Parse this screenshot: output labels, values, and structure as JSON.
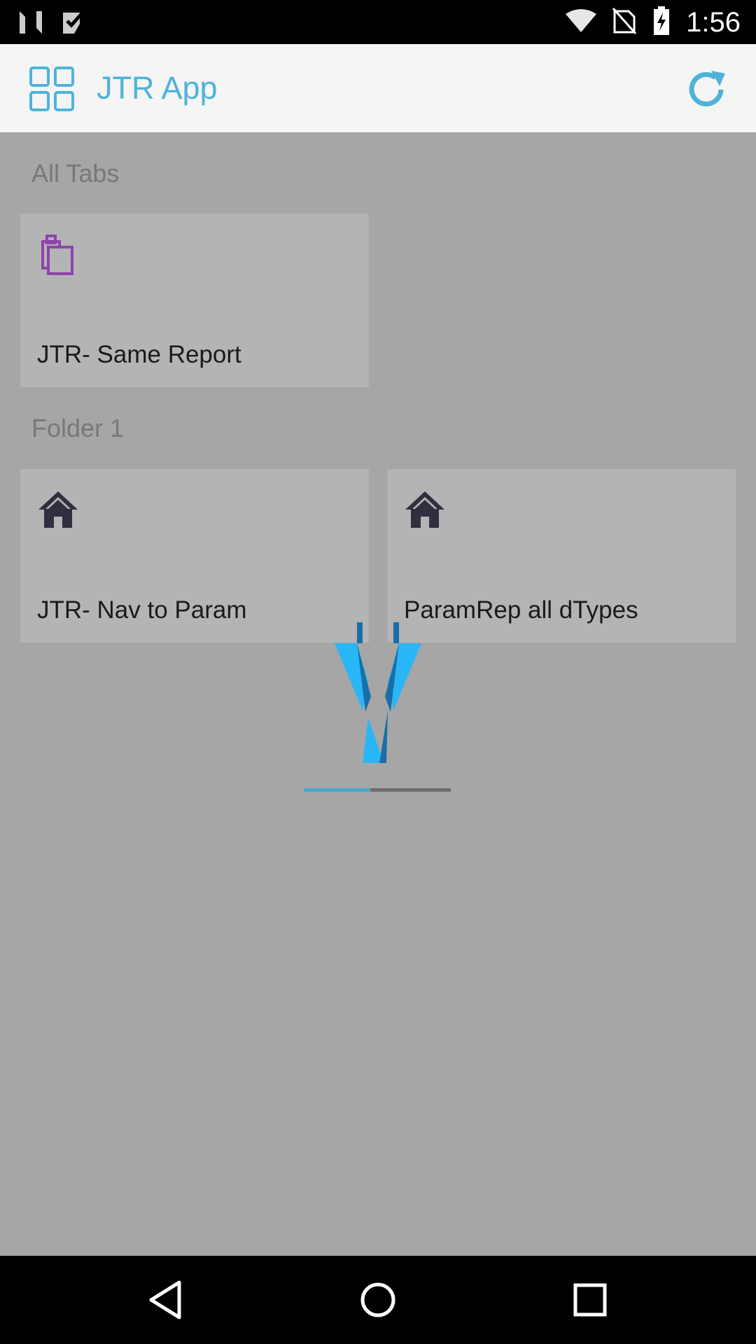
{
  "status_bar": {
    "time": "1:56",
    "left_icons": [
      "n-logo-icon",
      "check-notification-icon"
    ],
    "right_icons": [
      "wifi-icon",
      "no-sim-icon",
      "battery-charging-icon"
    ]
  },
  "app_bar": {
    "title": "JTR App",
    "app_icon": "grid-icon",
    "refresh_icon": "refresh-icon",
    "accent_color": "#4fb3d9"
  },
  "sections": [
    {
      "title": "All Tabs",
      "tiles": [
        {
          "label": "JTR- Same Report",
          "icon": "clipboard-icon",
          "icon_color": "#8e44ad"
        }
      ]
    },
    {
      "title": "Folder 1",
      "tiles": [
        {
          "label": "JTR- Nav to Param",
          "icon": "home-icon",
          "icon_color": "#2f2f3f"
        },
        {
          "label": "ParamRep all dTypes",
          "icon": "home-icon",
          "icon_color": "#2f2f3f"
        }
      ]
    }
  ],
  "loading": {
    "progress_fraction": 0.45,
    "colors": {
      "fill": "#4aa8cf",
      "track": "#6e6e6e"
    }
  },
  "nav_bar": {
    "buttons": [
      "back-icon",
      "home-circle-icon",
      "recents-icon"
    ]
  }
}
